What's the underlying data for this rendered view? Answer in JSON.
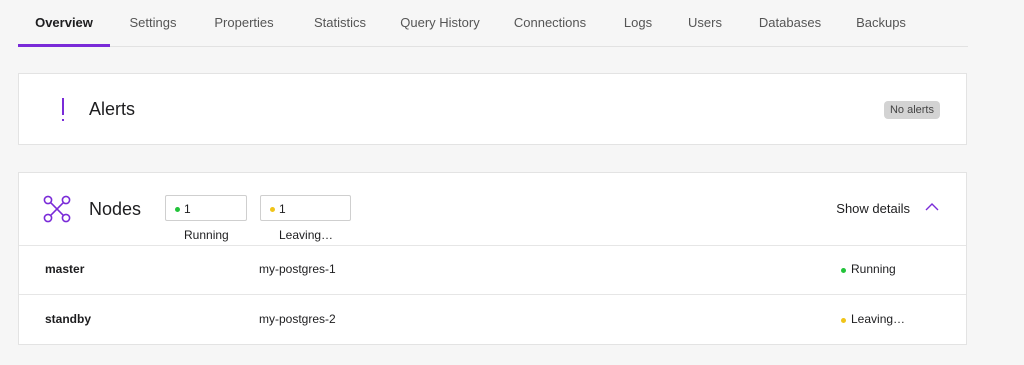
{
  "tabs": [
    {
      "label": "Overview",
      "active": true
    },
    {
      "label": "Settings"
    },
    {
      "label": "Properties"
    },
    {
      "label": "Statistics"
    },
    {
      "label": "Query History"
    },
    {
      "label": "Connections"
    },
    {
      "label": "Logs"
    },
    {
      "label": "Users"
    },
    {
      "label": "Databases"
    },
    {
      "label": "Backups"
    }
  ],
  "alerts": {
    "title": "Alerts",
    "badge": "No alerts"
  },
  "nodes": {
    "title": "Nodes",
    "running_pill": "1 Running",
    "leaving_pill": "1 Leaving…",
    "show_details": "Show details",
    "rows": [
      {
        "role": "master",
        "instance": "my-postgres-1",
        "status": "Running",
        "status_color": "#22c33a"
      },
      {
        "role": "standby",
        "instance": "my-postgres-2",
        "status": "Leaving…",
        "status_color": "#f0c419"
      }
    ]
  },
  "colors": {
    "accent": "#7a2bd8",
    "running": "#22c33a",
    "leaving": "#f0c419"
  }
}
